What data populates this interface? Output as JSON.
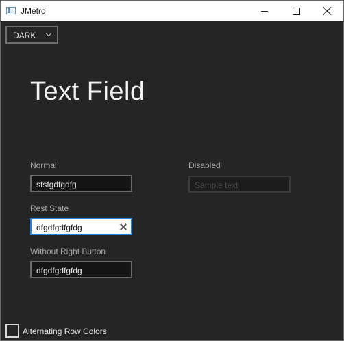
{
  "window": {
    "title": "JMetro",
    "icon": "app-window-icon",
    "controls": {
      "minimize": "minimize-icon",
      "maximize": "maximize-icon",
      "close": "close-icon"
    }
  },
  "theme_selector": {
    "value": "DARK",
    "icon": "chevron-down-icon"
  },
  "page": {
    "title": "Text Field"
  },
  "fields": {
    "normal": {
      "label": "Normal",
      "value": "sfsfgdfgdfg"
    },
    "disabled": {
      "label": "Disabled",
      "placeholder": "Sample text"
    },
    "rest_state": {
      "label": "Rest State",
      "value": "dfgdfgdfgfdg",
      "clear_icon": "clear-icon"
    },
    "without_right_button": {
      "label": "Without Right Button",
      "value": "dfgdfgdfgfdg"
    }
  },
  "alternating_rows": {
    "label": "Alternating Row Colors",
    "checked": false
  },
  "colors": {
    "background": "#252525",
    "accent": "#2a80d6",
    "text": "#e6e6e6",
    "label": "#a8a8a8"
  }
}
